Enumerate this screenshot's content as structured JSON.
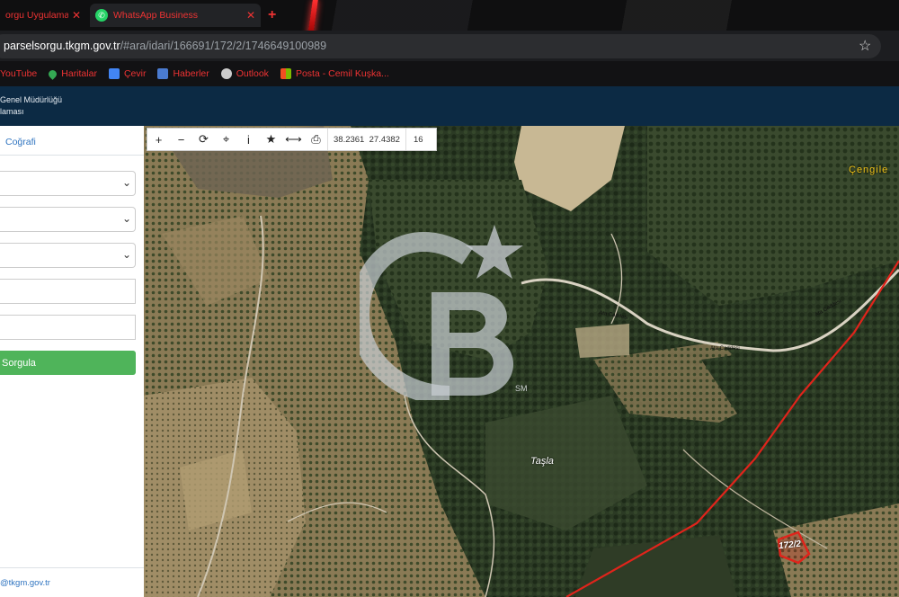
{
  "browser": {
    "tabs": [
      {
        "label": "orgu Uygulamas",
        "active": false
      },
      {
        "label": "WhatsApp Business",
        "active": true
      }
    ],
    "new_tab_glyph": "+",
    "close_glyph": "✕",
    "url_host": "parselsorgu.tkgm.gov.tr",
    "url_path": "/#ara/idari/166691/172/2/1746649100989",
    "bookmarks": [
      {
        "label": "YouTube",
        "icon": "youtube-icon",
        "color": "#ff0000"
      },
      {
        "label": "Haritalar",
        "icon": "maps-pin-icon",
        "color": "#34a853"
      },
      {
        "label": "Çevir",
        "icon": "translate-icon",
        "color": "#4285f4"
      },
      {
        "label": "Haberler",
        "icon": "news-icon",
        "color": "#4a7bd0"
      },
      {
        "label": "Outlook",
        "icon": "globe-icon",
        "color": "#cccccc"
      },
      {
        "label": "Posta - Cemil Kuşka...",
        "icon": "microsoft-icon",
        "color": "#f25022"
      }
    ]
  },
  "site_header": {
    "line1": "Genel Müdürlüğü",
    "line2": "laması"
  },
  "sidebar": {
    "tab_label": "Coğrafi",
    "query_button": "Sorgula",
    "email": "@tkgm.gov.tr"
  },
  "map_toolbar": {
    "coord_lat": "38.2361",
    "coord_lon": "27.4382",
    "zoom": "16"
  },
  "map_labels": {
    "place1": "Çengile",
    "place2": "Taşla",
    "road": "Ata Caddesi",
    "parcel": "172/2",
    "watermark_tm": "SM"
  },
  "colors": {
    "tab_text": "#ee3333",
    "header_bg": "#0c2a44",
    "button_green": "#4fb45a",
    "link_blue": "#2f74c0",
    "parcel_line": "#e0241b"
  }
}
